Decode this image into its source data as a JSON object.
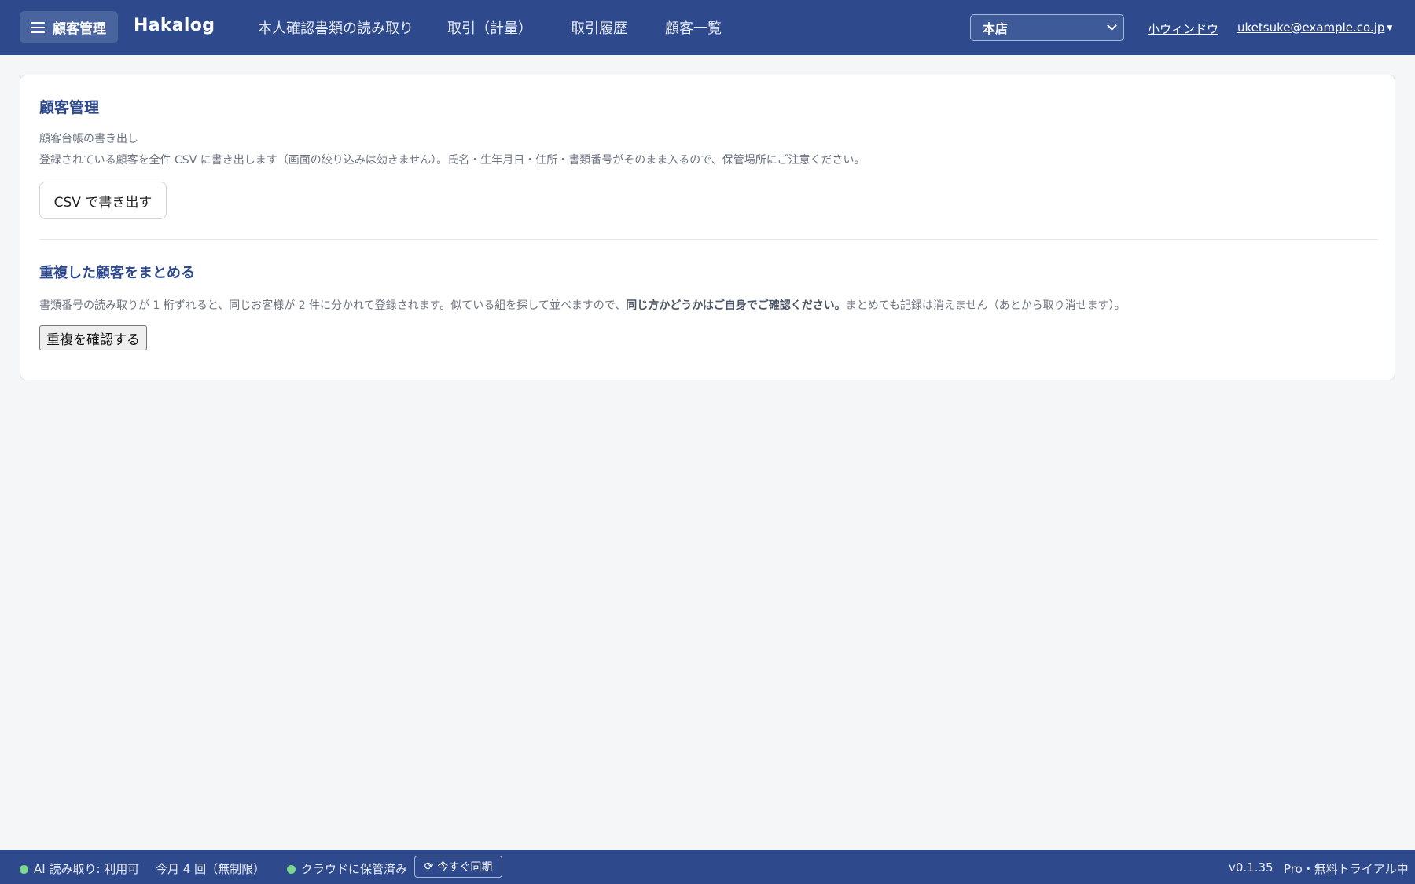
{
  "header": {
    "menu_label": "顧客管理",
    "brand": "Hakalog",
    "nav": [
      {
        "label": "本人確認書類の読み取り"
      },
      {
        "label": "取引（計量）"
      },
      {
        "label": "取引履歴"
      },
      {
        "label": "顧客一覧"
      }
    ],
    "store_selected": "本店",
    "mini_window_label": "小ウィンドウ",
    "user_email": "uketsuke@example.co.jp"
  },
  "main": {
    "title": "顧客管理",
    "export": {
      "heading": "顧客台帳の書き出し",
      "description": "登録されている顧客を全件 CSV に書き出します（画面の絞り込みは効きません）。氏名・生年月日・住所・書類番号がそのまま入るので、保管場所にご注意ください。",
      "button_label": "CSV で書き出す"
    },
    "merge": {
      "title": "重複した顧客をまとめる",
      "description_before": "書類番号の読み取りが 1 桁ずれると、同じお客様が 2 件に分かれて登録されます。似ている組を探して並べますので、",
      "description_bold": "同じ方かどうかはご自身でご確認ください。",
      "description_after": "まとめても記録は消えません（あとから取り消せます）。",
      "button_label": "重複を確認する"
    }
  },
  "footer": {
    "ai_status": "AI 読み取り: 利用可",
    "usage": "今月 4 回（無制限）",
    "cloud_status": "クラウドに保管済み",
    "sync_label": "今すぐ同期",
    "version": "v0.1.35",
    "plan": "Pro・無料トライアル中",
    "status_color": "#7bd88f"
  },
  "colors": {
    "primary": "#2e4a8c",
    "background": "#f4f6f8"
  }
}
